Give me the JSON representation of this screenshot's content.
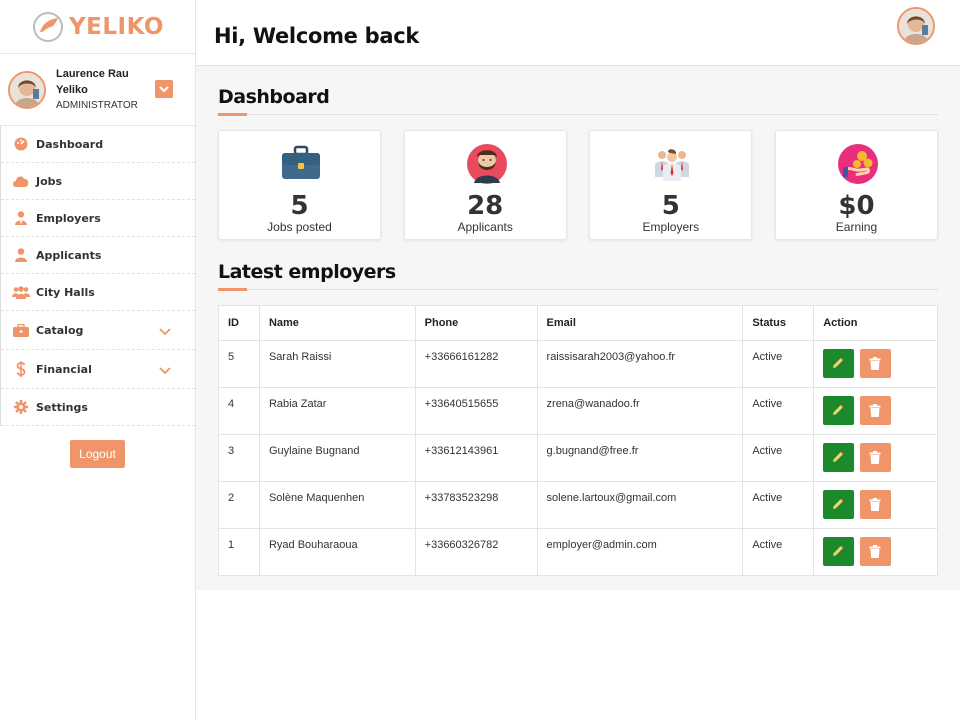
{
  "brand": {
    "name": "YELIKO",
    "accent": "#f0956a",
    "edit_color": "#1c8a2c"
  },
  "user": {
    "name": "Laurence Rau Yeliko",
    "role": "ADMINISTRATOR",
    "toggle_icon": "chevron-down-icon"
  },
  "sidebar": {
    "items": [
      {
        "label": "Dashboard",
        "icon": "gauge-icon"
      },
      {
        "label": "Jobs",
        "icon": "cloud-icon"
      },
      {
        "label": "Employers",
        "icon": "employer-icon"
      },
      {
        "label": "Applicants",
        "icon": "user-icon"
      },
      {
        "label": "City Halls",
        "icon": "users-icon"
      },
      {
        "label": "Catalog",
        "icon": "briefcase-icon",
        "expand_icon": "chevron-down-icon"
      },
      {
        "label": "Financial",
        "icon": "dollar-icon",
        "expand_icon": "chevron-down-icon"
      },
      {
        "label": "Settings",
        "icon": "gear-icon"
      }
    ],
    "logout_label": "Logout"
  },
  "header": {
    "welcome": "Hi, Welcome back"
  },
  "dashboard": {
    "title": "Dashboard",
    "cards": [
      {
        "value": "5",
        "label": "Jobs posted",
        "icon": "briefcase-icon"
      },
      {
        "value": "28",
        "label": "Applicants",
        "icon": "bearded-man-icon"
      },
      {
        "value": "5",
        "label": "Employers",
        "icon": "team-icon"
      },
      {
        "value": "$0",
        "label": "Earning",
        "icon": "coins-hand-icon"
      }
    ]
  },
  "employers": {
    "title": "Latest employers",
    "columns": [
      "ID",
      "Name",
      "Phone",
      "Email",
      "Status",
      "Action"
    ],
    "rows": [
      {
        "id": "5",
        "name": "Sarah Raissi",
        "phone": "+33666161282",
        "email": "raissisarah2003@yahoo.fr",
        "status": "Active"
      },
      {
        "id": "4",
        "name": "Rabia Zatar",
        "phone": "+33640515655",
        "email": "zrena@wanadoo.fr",
        "status": "Active"
      },
      {
        "id": "3",
        "name": "Guylaine Bugnand",
        "phone": "+33612143961",
        "email": "g.bugnand@free.fr",
        "status": "Active"
      },
      {
        "id": "2",
        "name": "Solène Maquenhen",
        "phone": "+33783523298",
        "email": "solene.lartoux@gmail.com",
        "status": "Active"
      },
      {
        "id": "1",
        "name": "Ryad Bouharaoua",
        "phone": "+33660326782",
        "email": "employer@admin.com",
        "status": "Active"
      }
    ],
    "edit_icon": "pencil-icon",
    "delete_icon": "trash-icon"
  }
}
